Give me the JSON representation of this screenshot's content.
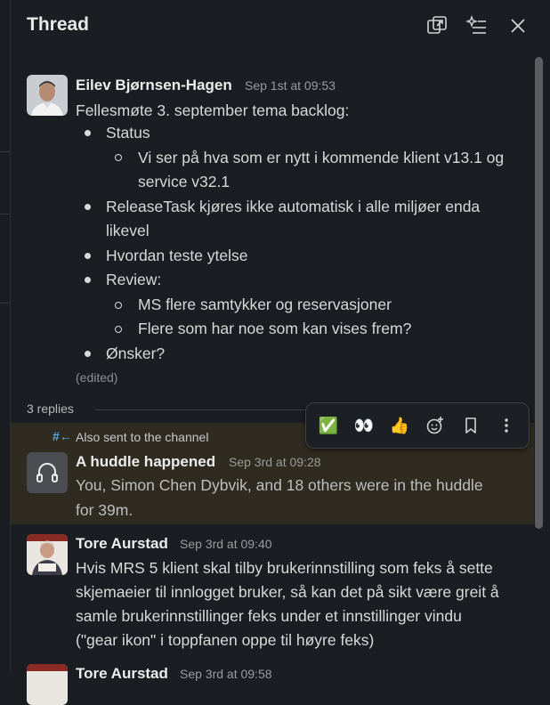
{
  "header": {
    "title": "Thread"
  },
  "parent": {
    "author": "Eilev Bjørnsen-Hagen",
    "time": "Sep 1st at 09:53",
    "intro": "Fellesmøte 3. september tema backlog:",
    "b1": "Status",
    "b1s1a": "Vi ser på hva som er nytt i kommende klient v13.1 og",
    "b1s1b": "service v32.1",
    "b2a": "ReleaseTask kjøres ikke automatisk i alle miljøer enda",
    "b2b": "likevel",
    "b3": "Hvordan teste ytelse",
    "b4": "Review:",
    "b4s1": "MS flere samtykker og reservasjoner",
    "b4s2": "Flere som har noe som kan vises frem?",
    "b5": "Ønsker?",
    "edited": "(edited)"
  },
  "replies_count": "3 replies",
  "huddle": {
    "also_sent": "Also sent to the channel",
    "author": "A huddle happened",
    "time": "Sep 3rd at 09:28",
    "line1": "You, Simon Chen Dybvik, and 18 others were in the huddle",
    "line2": "for 39m."
  },
  "reply1": {
    "author": "Tore Aurstad",
    "time": "Sep 3rd at 09:40",
    "line1": "Hvis MRS 5 klient skal tilby brukerinnstilling som feks å sette",
    "line2": "skjemaeier til innlogget bruker, så kan det på sikt være greit å",
    "line3": "samle brukerinnstillinger feks under et innstillinger vindu",
    "line4": "(\"gear ikon\" i toppfanen oppe til høyre feks)"
  },
  "reply2": {
    "author": "Tore Aurstad",
    "time": "Sep 3rd at 09:58"
  },
  "toolbar": {
    "check": "✅",
    "eyes": "👀",
    "thumbs": "👍"
  },
  "colors": {
    "background": "#1a1d21",
    "highlight": "#2f2b20",
    "link": "#5aa9e6"
  }
}
